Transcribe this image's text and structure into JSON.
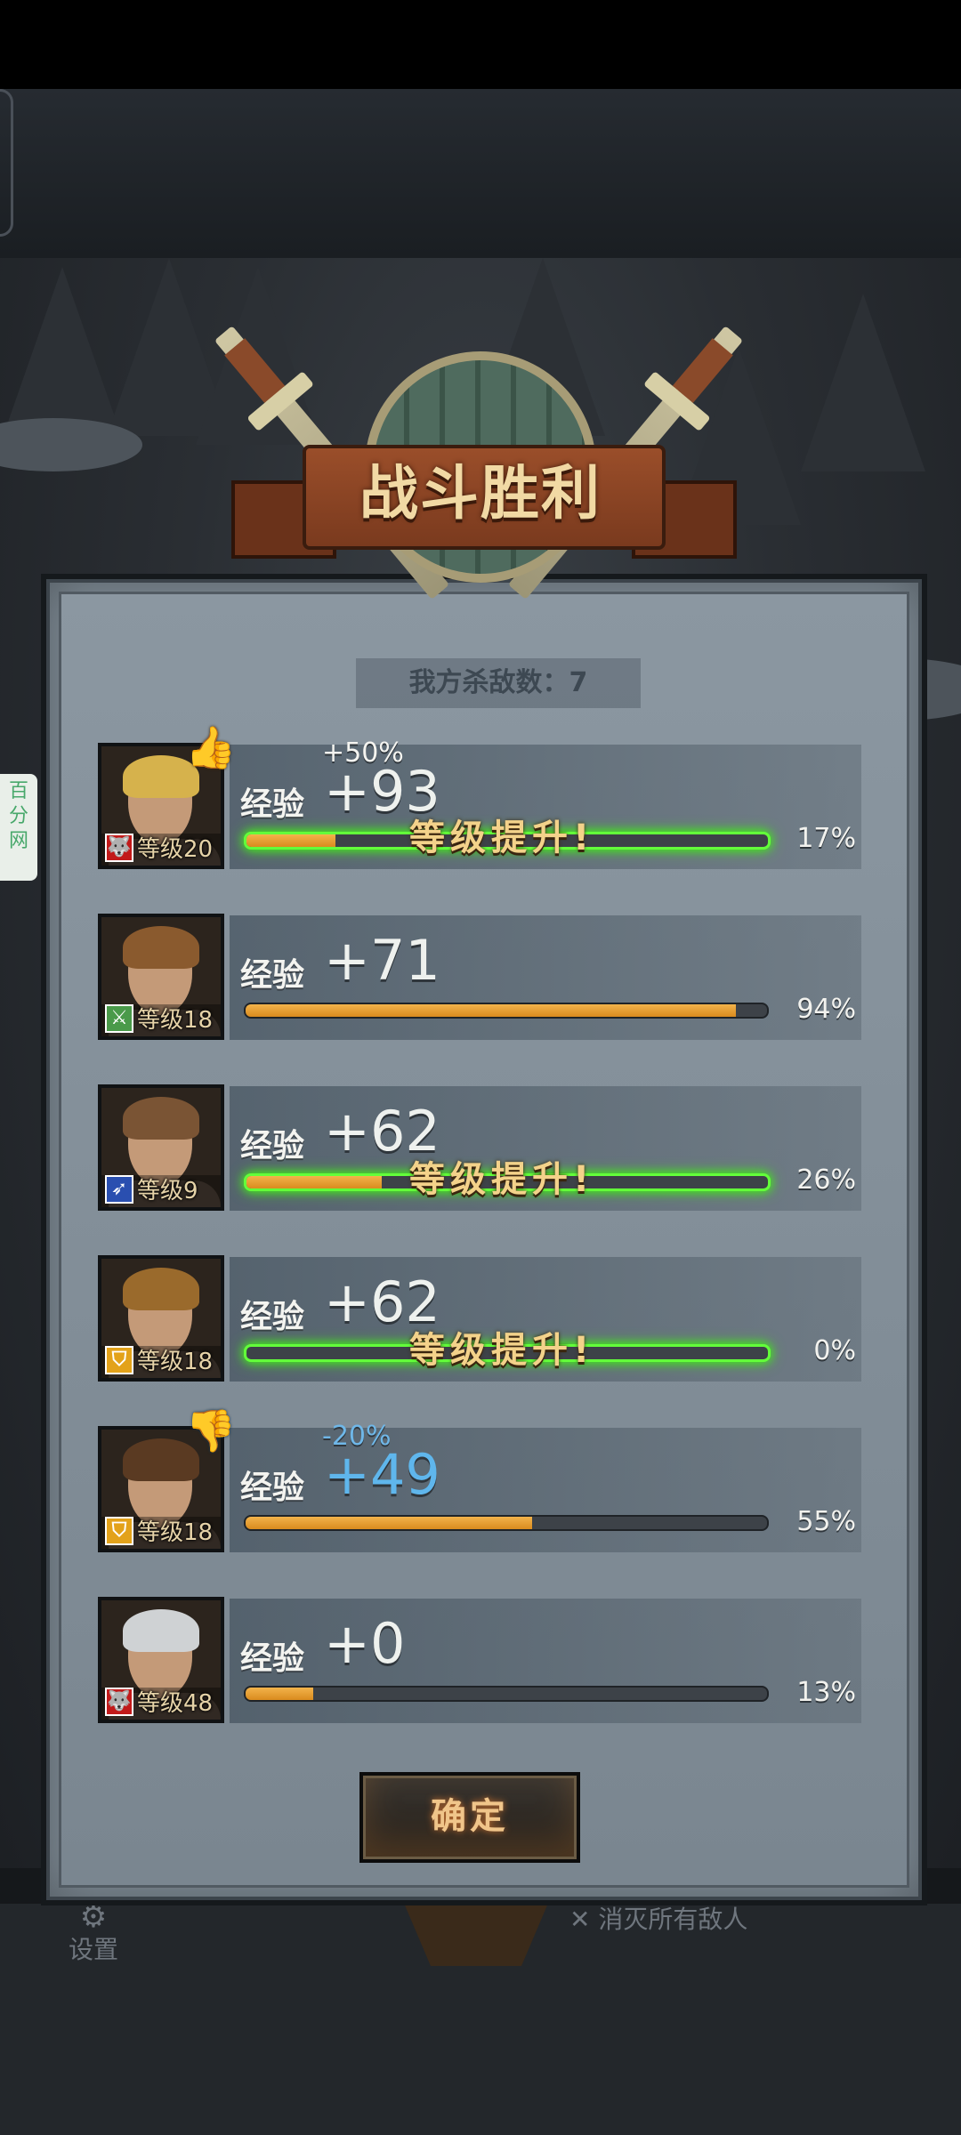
{
  "title": "战斗胜利",
  "kills_text": "我方杀敌数：7",
  "side_tag": "百分网",
  "confirm_label": "确定",
  "bottom": {
    "settings_label": "设置",
    "objective_text": "消灭所有敌人"
  },
  "heroes": [
    {
      "level_text": "等级20",
      "exp_label": "经验",
      "exp_gain": "+93",
      "bonus": "+50%",
      "bonus_type": "positive",
      "level_up": "等级提升!",
      "leveled": true,
      "progress": 0.17,
      "percent": "17%",
      "class_icon": "wolf-icon",
      "class_color": "#c21a1a"
    },
    {
      "level_text": "等级18",
      "exp_label": "经验",
      "exp_gain": "+71",
      "bonus": "",
      "bonus_type": "none",
      "level_up": "",
      "leveled": false,
      "progress": 0.94,
      "percent": "94%",
      "class_icon": "crossed-swords-icon",
      "class_color": "#4a9a4a"
    },
    {
      "level_text": "等级9",
      "exp_label": "经验",
      "exp_gain": "+62",
      "bonus": "",
      "bonus_type": "none",
      "level_up": "等级提升!",
      "leveled": true,
      "progress": 0.26,
      "percent": "26%",
      "class_icon": "spear-icon",
      "class_color": "#2a4fb0"
    },
    {
      "level_text": "等级18",
      "exp_label": "经验",
      "exp_gain": "+62",
      "bonus": "",
      "bonus_type": "none",
      "level_up": "等级提升!",
      "leveled": true,
      "progress": 0.0,
      "percent": "0%",
      "class_icon": "shield-icon",
      "class_color": "#e3a21a"
    },
    {
      "level_text": "等级18",
      "exp_label": "经验",
      "exp_gain": "+49",
      "bonus": "-20%",
      "bonus_type": "negative",
      "level_up": "",
      "leveled": false,
      "progress": 0.55,
      "percent": "55%",
      "class_icon": "shield-icon",
      "class_color": "#e3a21a"
    },
    {
      "level_text": "等级48",
      "exp_label": "经验",
      "exp_gain": "+0",
      "bonus": "",
      "bonus_type": "none",
      "level_up": "",
      "leveled": false,
      "progress": 0.13,
      "percent": "13%",
      "class_icon": "wolf-icon",
      "class_color": "#c21a1a"
    }
  ]
}
